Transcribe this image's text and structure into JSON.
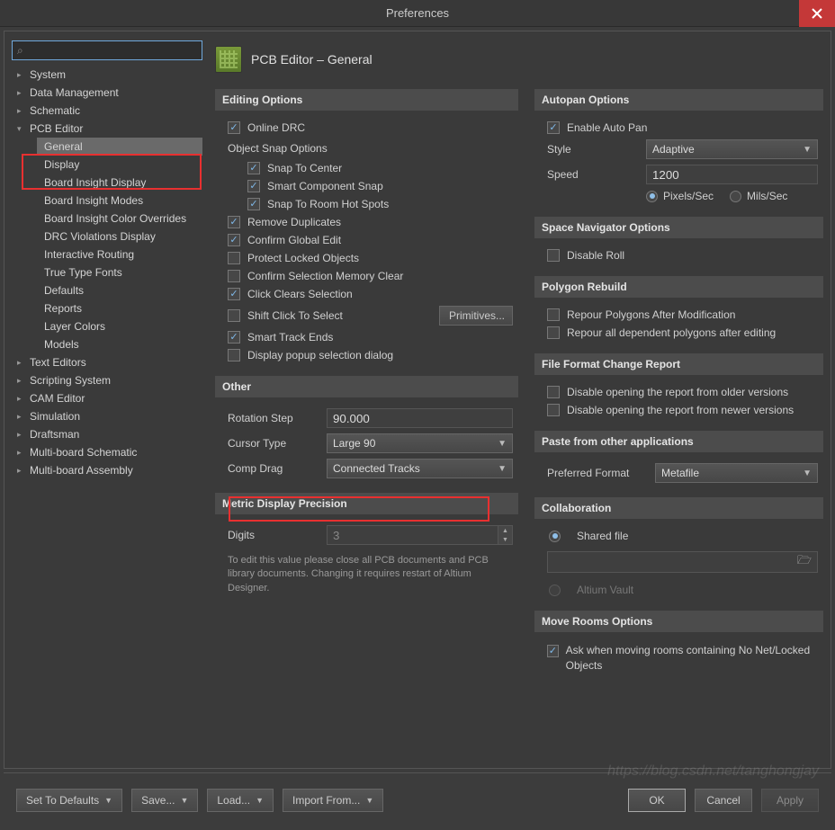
{
  "window": {
    "title": "Preferences"
  },
  "search": {
    "placeholder": ""
  },
  "tree": {
    "items": [
      {
        "label": "System",
        "expanded": false
      },
      {
        "label": "Data Management",
        "expanded": false
      },
      {
        "label": "Schematic",
        "expanded": false
      },
      {
        "label": "PCB Editor",
        "expanded": true,
        "children": [
          {
            "label": "General",
            "selected": true
          },
          {
            "label": "Display"
          },
          {
            "label": "Board Insight Display"
          },
          {
            "label": "Board Insight Modes"
          },
          {
            "label": "Board Insight Color Overrides"
          },
          {
            "label": "DRC Violations Display"
          },
          {
            "label": "Interactive Routing"
          },
          {
            "label": "True Type Fonts"
          },
          {
            "label": "Defaults"
          },
          {
            "label": "Reports"
          },
          {
            "label": "Layer Colors"
          },
          {
            "label": "Models"
          }
        ]
      },
      {
        "label": "Text Editors",
        "expanded": false
      },
      {
        "label": "Scripting System",
        "expanded": false
      },
      {
        "label": "CAM Editor",
        "expanded": false
      },
      {
        "label": "Simulation",
        "expanded": false
      },
      {
        "label": "Draftsman",
        "expanded": false
      },
      {
        "label": "Multi-board Schematic",
        "expanded": false
      },
      {
        "label": "Multi-board Assembly",
        "expanded": false
      }
    ]
  },
  "page": {
    "title": "PCB Editor – General"
  },
  "editing": {
    "heading": "Editing Options",
    "online_drc": {
      "label": "Online DRC",
      "checked": true
    },
    "snap_heading": "Object Snap Options",
    "snap_center": {
      "label": "Snap To Center",
      "checked": true
    },
    "smart_snap": {
      "label": "Smart Component Snap",
      "checked": true
    },
    "snap_room": {
      "label": "Snap To Room Hot Spots",
      "checked": true
    },
    "remove_dup": {
      "label": "Remove Duplicates",
      "checked": true
    },
    "confirm_global": {
      "label": "Confirm Global Edit",
      "checked": true
    },
    "protect_locked": {
      "label": "Protect Locked Objects",
      "checked": false
    },
    "confirm_sel_mem": {
      "label": "Confirm Selection Memory Clear",
      "checked": false
    },
    "click_clears": {
      "label": "Click Clears Selection",
      "checked": true
    },
    "shift_click": {
      "label": "Shift Click To Select",
      "checked": false
    },
    "primitives_btn": "Primitives...",
    "smart_track": {
      "label": "Smart Track Ends",
      "checked": true
    },
    "popup_dialog": {
      "label": "Display popup selection dialog",
      "checked": false
    }
  },
  "other": {
    "heading": "Other",
    "rotation_label": "Rotation Step",
    "rotation_value": "90.000",
    "cursor_label": "Cursor Type",
    "cursor_value": "Large 90",
    "comp_drag_label": "Comp Drag",
    "comp_drag_value": "Connected Tracks"
  },
  "metric": {
    "heading": "Metric Display Precision",
    "digits_label": "Digits",
    "digits_value": "3",
    "note": "To edit this value please close all PCB documents and PCB library documents. Changing it requires restart of Altium Designer."
  },
  "autopan": {
    "heading": "Autopan Options",
    "enable": {
      "label": "Enable Auto Pan",
      "checked": true
    },
    "style_label": "Style",
    "style_value": "Adaptive",
    "speed_label": "Speed",
    "speed_value": "1200",
    "pixels": "Pixels/Sec",
    "mils": "Mils/Sec"
  },
  "spacenav": {
    "heading": "Space Navigator Options",
    "disable_roll": {
      "label": "Disable Roll",
      "checked": false
    }
  },
  "polygon": {
    "heading": "Polygon Rebuild",
    "repour_mod": {
      "label": "Repour Polygons After Modification",
      "checked": false
    },
    "repour_dep": {
      "label": "Repour all dependent polygons after editing",
      "checked": false
    }
  },
  "fileformat": {
    "heading": "File Format Change Report",
    "older": {
      "label": "Disable opening the report from older versions",
      "checked": false
    },
    "newer": {
      "label": "Disable opening the report from newer versions",
      "checked": false
    }
  },
  "paste": {
    "heading": "Paste from other applications",
    "pref_label": "Preferred Format",
    "pref_value": "Metafile"
  },
  "collab": {
    "heading": "Collaboration",
    "shared": "Shared file",
    "vault": "Altium Vault"
  },
  "rooms": {
    "heading": "Move Rooms Options",
    "ask": {
      "label": "Ask when moving rooms containing No Net/Locked Objects",
      "checked": true
    }
  },
  "footer": {
    "defaults": "Set To Defaults",
    "save": "Save...",
    "load": "Load...",
    "import": "Import From...",
    "ok": "OK",
    "cancel": "Cancel",
    "apply": "Apply"
  },
  "watermark": "https://blog.csdn.net/tanghongjay"
}
